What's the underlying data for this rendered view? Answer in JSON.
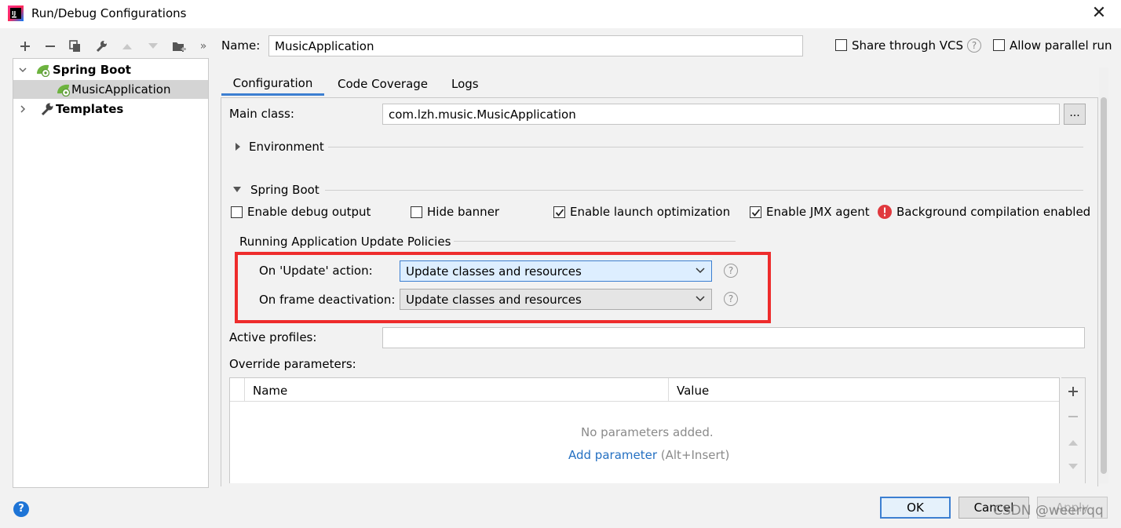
{
  "window": {
    "title": "Run/Debug Configurations"
  },
  "toolbar": {
    "items": [
      "add-icon",
      "remove-icon",
      "copy-icon",
      "wrench-icon",
      "arrow-up-icon",
      "arrow-down-icon",
      "folder-add-icon",
      "more-icon"
    ],
    "more": "»"
  },
  "tree": {
    "groups": [
      {
        "label": "Spring Boot",
        "expanded": true,
        "children": [
          "MusicApplication"
        ]
      },
      {
        "label": "Templates",
        "expanded": false
      }
    ]
  },
  "name_field": {
    "label": "Name:",
    "value": "MusicApplication"
  },
  "header_options": {
    "share_vcs": {
      "label": "Share through VCS",
      "checked": false
    },
    "allow_parallel": {
      "label": "Allow parallel run",
      "checked": false
    }
  },
  "tabs": [
    "Configuration",
    "Code Coverage",
    "Logs"
  ],
  "active_tab": "Configuration",
  "config": {
    "main_class_label": "Main class:",
    "main_class_value": "com.lzh.music.MusicApplication",
    "browse_label": "...",
    "environment_label": "Environment",
    "spring_boot_label": "Spring Boot",
    "options": {
      "debug_output": {
        "label": "Enable debug output",
        "checked": false
      },
      "hide_banner": {
        "label": "Hide banner",
        "checked": false
      },
      "launch_optimization": {
        "label": "Enable launch optimization",
        "checked": true
      },
      "jmx_agent": {
        "label": "Enable JMX agent",
        "checked": true
      }
    },
    "bg_compilation_text": "Background compilation enabled",
    "policies_label": "Running Application Update Policies",
    "on_update_label": "On 'Update' action:",
    "on_update_value": "Update classes and resources",
    "on_frame_label": "On frame deactivation:",
    "on_frame_value": "Update classes and resources",
    "active_profiles_label": "Active profiles:",
    "active_profiles_value": "",
    "override_label": "Override parameters:",
    "table": {
      "columns": [
        "Name",
        "Value"
      ],
      "empty_text": "No parameters added.",
      "add_link": "Add parameter",
      "add_hint": "(Alt+Insert)"
    }
  },
  "buttons": {
    "ok": "OK",
    "cancel": "Cancel",
    "apply": "Apply"
  },
  "help_label": "?",
  "watermark": "CSDN @weerrqq",
  "colors": {
    "accent": "#3c7fd1",
    "highlight_box": "#ee2c2c",
    "spring_green": "#6db33f",
    "error_red": "#e0393e",
    "link": "#2470c2"
  }
}
